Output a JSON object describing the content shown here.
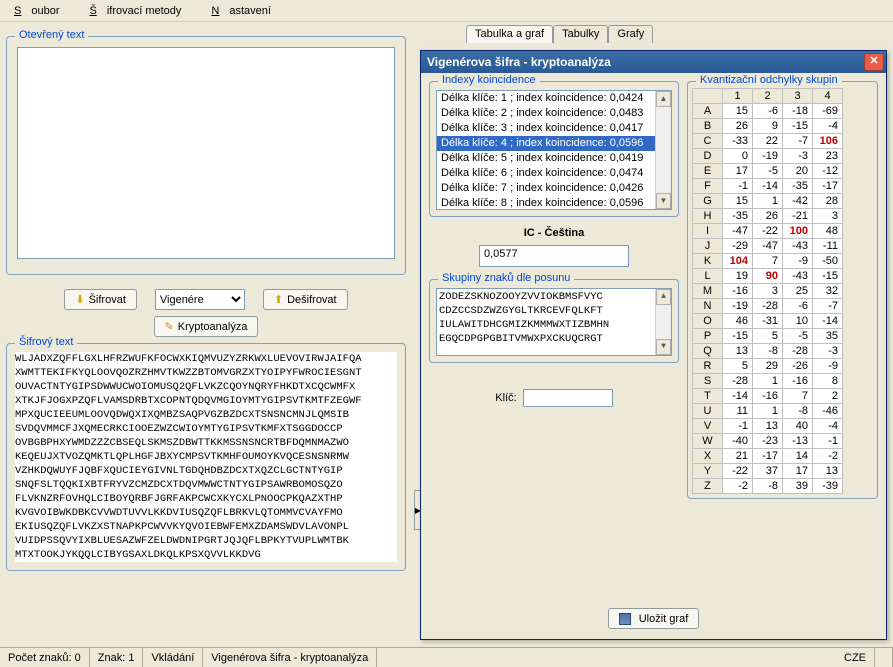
{
  "menu": {
    "file": "Soubor",
    "methods": "Šifrovací metody",
    "settings": "Nastavení"
  },
  "outer_tabs": [
    "Tabulka a graf",
    "Tabulky",
    "Grafy"
  ],
  "open_text": {
    "legend": "Otevřený text"
  },
  "buttons": {
    "encrypt": "Šifrovat",
    "decrypt": "Dešifrovat",
    "crypto": "Kryptoanalýza"
  },
  "algo": {
    "selected": "Vigenére"
  },
  "cipher": {
    "legend": "Šifrový text",
    "lines": [
      "WLJADXZQFFLGXLHFRZWUFKFOCWXKIQMVUZYZRKWXLUEVOVIRWJAIFQA",
      "XWMTTEKIFKYQLOOVQOZRZHMVTKWZZBTOMVGRZXTYOIPYFWROCIESGNT",
      "OUVACTNTYGIPSDWWUCWOIOMUSQ2QFLVKZCQOYNQRYFHKDTXCQCWMFX",
      "XTKJFJOGXPZQFLVAMSDRBTXCOPNTQDQVMGIOYMTYGIPSVTKMTFZEGWF",
      "MPXQUCIEEUMLOOVQDWQXIXQMBZSAQPVGZBZDCXTSNSNCMNJLQMSIB",
      "SVDQVMMCFJXQMECRKCIOOEZWZCWIOYMTYGIPSVTKMFXTSGGDOCCP",
      "OVBGBPHXYWMDZZZCBSEQLSKMSZDBWTTKKMSSNSNCRTBFDQMNMAZWO",
      "KEQEUJXTVOZQMKTLQPLHGFJBXYCMPSVTKMHFOUMOYKVQCESNSNRMW",
      "VZHKDQWUYFJQBFXQUCIEYGIVNLTGDQHDBZDCXTXQZCLGCTNTYGIP",
      "SNQFSLTQQKIXBTFRYVZCMZDCXTDQVMWWCTNTYGIPSAWRBOMOSQZO",
      "FLVKNZRFOVHQLCIBOYQRBFJGRFAKPCWCXKYCXLPNOOCPKQAZXTHP",
      "KVGVOIBWKDBKCVVWDTUVVLKKDVIUSQZQFLBRKVLQTOMMVCVAYFMO",
      "EKIUSQZQFLVKZXSTNAPKPCWVVKYQVOIEBWFEMXZDAMSWDVLAVONPL",
      "VUIDPSSQVYIXBLUESAZWFZELDWDNIPGRTJQJQFLBPKYTVUPLWMTBK",
      "MTXTOOKJYKQQLCIBYGSAXLDKQLKPSXQVVLKKDVG"
    ]
  },
  "dialog": {
    "title": "Vigenérova šifra - kryptoanalýza",
    "indexes_legend": "Indexy koincidence",
    "indexes": [
      "Délka klíče: 1 ; index koincidence: 0,0424",
      "Délka klíče: 2 ; index koincidence: 0,0483",
      "Délka klíče: 3 ; index koincidence: 0,0417",
      "Délka klíče: 4 ; index koincidence: 0,0596",
      "Délka klíče: 5 ; index koincidence: 0,0419",
      "Délka klíče: 6 ; index koincidence: 0,0474",
      "Délka klíče: 7 ; index koincidence: 0,0426",
      "Délka klíče: 8 ; index koincidence: 0,0596"
    ],
    "indexes_selected": 3,
    "ic_label": "IC - Čeština",
    "ic_value": "0,0577",
    "groups_legend": "Skupiny znaků dle posunu",
    "groups": [
      "ZODEZSKNOZOOYZVVIOKBMSFVYC",
      "CDZCCSDZWZGYGLTKRCEVFQLKFT",
      "IULAWITDHCGMIZKMMMWXTIZBMHN",
      "EGQCDPGPGBITVMWXPXCKUQCRGT"
    ],
    "key_label": "Klíč:",
    "dev_legend": "Kvantizační odchylky skupin",
    "dev_cols": [
      "1",
      "2",
      "3",
      "4"
    ],
    "dev_rows": [
      {
        "l": "A",
        "v": [
          "15",
          "-6",
          "-18",
          "-69"
        ],
        "r": []
      },
      {
        "l": "B",
        "v": [
          "26",
          "9",
          "-15",
          "-4"
        ],
        "r": []
      },
      {
        "l": "C",
        "v": [
          "-33",
          "22",
          "-7",
          "106"
        ],
        "r": [
          3
        ]
      },
      {
        "l": "D",
        "v": [
          "0",
          "-19",
          "-3",
          "23"
        ],
        "r": []
      },
      {
        "l": "E",
        "v": [
          "17",
          "-5",
          "20",
          "-12"
        ],
        "r": []
      },
      {
        "l": "F",
        "v": [
          "-1",
          "-14",
          "-35",
          "-17"
        ],
        "r": []
      },
      {
        "l": "G",
        "v": [
          "15",
          "1",
          "-42",
          "28"
        ],
        "r": []
      },
      {
        "l": "H",
        "v": [
          "-35",
          "26",
          "-21",
          "3"
        ],
        "r": []
      },
      {
        "l": "I",
        "v": [
          "-47",
          "-22",
          "100",
          "48"
        ],
        "r": [
          2
        ]
      },
      {
        "l": "J",
        "v": [
          "-29",
          "-47",
          "-43",
          "-11"
        ],
        "r": []
      },
      {
        "l": "K",
        "v": [
          "104",
          "7",
          "-9",
          "-50"
        ],
        "r": [
          0
        ]
      },
      {
        "l": "L",
        "v": [
          "19",
          "90",
          "-43",
          "-15"
        ],
        "r": [
          1
        ]
      },
      {
        "l": "M",
        "v": [
          "-16",
          "3",
          "25",
          "32"
        ],
        "r": []
      },
      {
        "l": "N",
        "v": [
          "-19",
          "-28",
          "-6",
          "-7"
        ],
        "r": []
      },
      {
        "l": "O",
        "v": [
          "46",
          "-31",
          "10",
          "-14"
        ],
        "r": []
      },
      {
        "l": "P",
        "v": [
          "-15",
          "5",
          "-5",
          "35"
        ],
        "r": []
      },
      {
        "l": "Q",
        "v": [
          "13",
          "-8",
          "-28",
          "-3"
        ],
        "r": []
      },
      {
        "l": "R",
        "v": [
          "5",
          "29",
          "-26",
          "-9"
        ],
        "r": []
      },
      {
        "l": "S",
        "v": [
          "-28",
          "1",
          "-16",
          "8"
        ],
        "r": []
      },
      {
        "l": "T",
        "v": [
          "-14",
          "-16",
          "7",
          "2"
        ],
        "r": []
      },
      {
        "l": "U",
        "v": [
          "11",
          "1",
          "-8",
          "-46"
        ],
        "r": []
      },
      {
        "l": "V",
        "v": [
          "-1",
          "13",
          "40",
          "-4"
        ],
        "r": []
      },
      {
        "l": "W",
        "v": [
          "-40",
          "-23",
          "-13",
          "-1"
        ],
        "r": []
      },
      {
        "l": "X",
        "v": [
          "21",
          "-17",
          "14",
          "-2"
        ],
        "r": []
      },
      {
        "l": "Y",
        "v": [
          "-22",
          "37",
          "17",
          "13"
        ],
        "r": []
      },
      {
        "l": "Z",
        "v": [
          "-2",
          "-8",
          "39",
          "-39"
        ],
        "r": []
      }
    ],
    "save": "Uložit graf"
  },
  "status": {
    "chars": "Počet znaků: 0",
    "sign": "Znak: 1",
    "mode": "Vkládání",
    "state": "Vigenérova šifra - kryptoanalýza",
    "lang": "CZE"
  }
}
